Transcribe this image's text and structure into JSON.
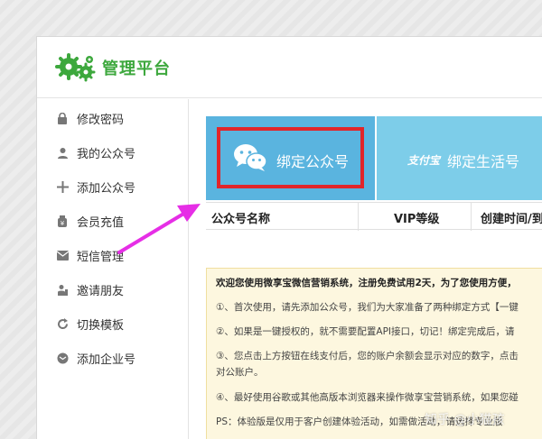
{
  "brand": {
    "title": "管理平台"
  },
  "sidebar": {
    "items": [
      {
        "label": "修改密码",
        "icon": "lock-icon"
      },
      {
        "label": "我的公众号",
        "icon": "user-icon"
      },
      {
        "label": "添加公众号",
        "icon": "plus-icon"
      },
      {
        "label": "会员充值",
        "icon": "wallet-icon"
      },
      {
        "label": "短信管理",
        "icon": "envelope-icon"
      },
      {
        "label": "邀请朋友",
        "icon": "invite-icon"
      },
      {
        "label": "切换模板",
        "icon": "refresh-icon"
      },
      {
        "label": "添加企业号",
        "icon": "mail-icon"
      }
    ]
  },
  "tabs": {
    "wechat": {
      "label": "绑定公众号"
    },
    "alipay": {
      "label": "绑定生活号",
      "logo_text": "支付宝"
    }
  },
  "table": {
    "headers": [
      "公众号名称",
      "VIP等级",
      "创建时间/到"
    ]
  },
  "notice": {
    "lines": [
      "欢迎您使用微享宝微信营销系统，注册免费试用2天，为了您使用方便，",
      "①、首次使用，请先添加公众号，我们为大家准备了两种绑定方式【一键",
      "②、如果是一键授权的，就不需要配置API接口，切记！绑定完成后，请",
      "③、您点击上方按钮在线支付后，您的账户余额会显示对应的数字，点击",
      "对公账户。",
      "④、最好使用谷歌或其他高版本浏览器来操作微享宝营销系统，如果您碰",
      "PS：体验版是仅用于客户创建体验活动，如需做活动，请选择专业版"
    ]
  },
  "watermark": {
    "text": "知乎 @小猫孩"
  },
  "colors": {
    "brand_green": "#3da83d",
    "tab_wechat": "#5ab4df",
    "tab_alipay": "#7dcde9",
    "highlight_red": "#e1252a",
    "arrow_magenta": "#e62ee6"
  }
}
